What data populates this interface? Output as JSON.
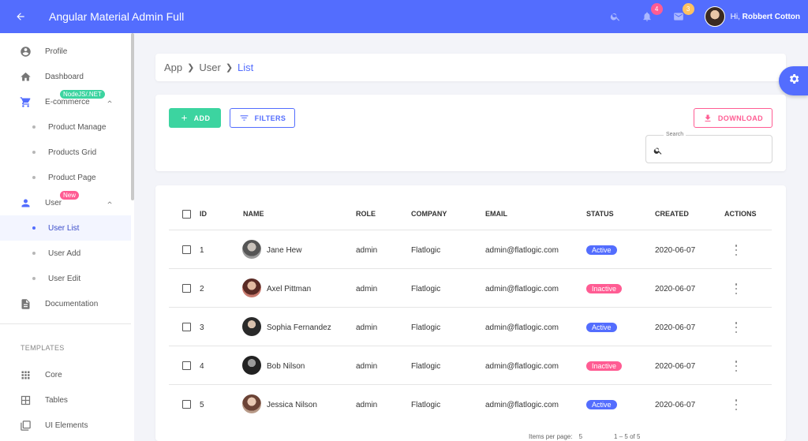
{
  "header": {
    "title": "Angular Material Admin Full",
    "notifications_count": "4",
    "messages_count": "3",
    "greeting_prefix": "Hi,",
    "user_name": "Robbert Cotton"
  },
  "sidebar": {
    "items": [
      {
        "label": "Profile",
        "icon": "account-circle-icon"
      },
      {
        "label": "Dashboard",
        "icon": "home-icon"
      },
      {
        "label": "E-commerce",
        "icon": "cart-icon",
        "tag": "NodeJS/.NET"
      },
      {
        "label": "Product Manage"
      },
      {
        "label": "Products Grid"
      },
      {
        "label": "Product Page"
      },
      {
        "label": "User",
        "icon": "person-icon",
        "tag": "New"
      },
      {
        "label": "User List"
      },
      {
        "label": "User Add"
      },
      {
        "label": "User Edit"
      },
      {
        "label": "Documentation",
        "icon": "document-icon"
      }
    ],
    "section_title": "TEMPLATES",
    "templates": [
      {
        "label": "Core",
        "icon": "grid-icon"
      },
      {
        "label": "Tables",
        "icon": "table-icon"
      },
      {
        "label": "UI Elements",
        "icon": "layers-icon"
      }
    ]
  },
  "breadcrumb": [
    "App",
    "User",
    "List"
  ],
  "toolbar": {
    "add_label": "ADD",
    "filters_label": "FILTERS",
    "download_label": "DOWNLOAD",
    "search_label": "Search",
    "search_value": ""
  },
  "table": {
    "columns": [
      "ID",
      "NAME",
      "ROLE",
      "COMPANY",
      "EMAIL",
      "STATUS",
      "CREATED",
      "ACTIONS"
    ],
    "rows": [
      {
        "id": "1",
        "name": "Jane Hew",
        "role": "admin",
        "company": "Flatlogic",
        "email": "admin@flatlogic.com",
        "status": "Active",
        "created": "2020-06-07"
      },
      {
        "id": "2",
        "name": "Axel Pittman",
        "role": "admin",
        "company": "Flatlogic",
        "email": "admin@flatlogic.com",
        "status": "Inactive",
        "created": "2020-06-07"
      },
      {
        "id": "3",
        "name": "Sophia Fernandez",
        "role": "admin",
        "company": "Flatlogic",
        "email": "admin@flatlogic.com",
        "status": "Active",
        "created": "2020-06-07"
      },
      {
        "id": "4",
        "name": "Bob Nilson",
        "role": "admin",
        "company": "Flatlogic",
        "email": "admin@flatlogic.com",
        "status": "Inactive",
        "created": "2020-06-07"
      },
      {
        "id": "5",
        "name": "Jessica Nilson",
        "role": "admin",
        "company": "Flatlogic",
        "email": "admin@flatlogic.com",
        "status": "Active",
        "created": "2020-06-07"
      }
    ]
  },
  "pagination": {
    "items_per_page_label": "Items per page:",
    "page_size": "5",
    "range": "1 – 5 of 5"
  },
  "colors": {
    "primary": "#536dfe",
    "success": "#3cd4a0",
    "secondary": "#ff5c93",
    "warning": "#ffc260"
  }
}
